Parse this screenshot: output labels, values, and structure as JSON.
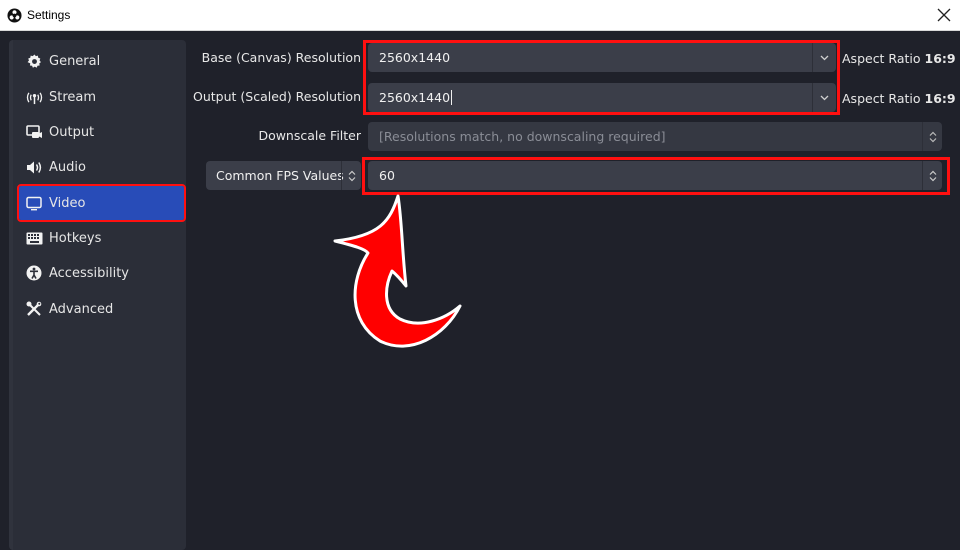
{
  "window": {
    "title": "Settings",
    "app_icon": "obs-logo-icon",
    "close_icon": "close-icon"
  },
  "sidebar": {
    "items": [
      {
        "label": "General",
        "icon": "gear-icon"
      },
      {
        "label": "Stream",
        "icon": "antenna-icon"
      },
      {
        "label": "Output",
        "icon": "output-icon"
      },
      {
        "label": "Audio",
        "icon": "speaker-icon"
      },
      {
        "label": "Video",
        "icon": "monitor-icon",
        "active": true
      },
      {
        "label": "Hotkeys",
        "icon": "keyboard-icon"
      },
      {
        "label": "Accessibility",
        "icon": "accessibility-icon"
      },
      {
        "label": "Advanced",
        "icon": "tools-icon"
      }
    ]
  },
  "video": {
    "base_resolution": {
      "label": "Base (Canvas) Resolution",
      "value": "2560x1440",
      "aspect_label": "Aspect Ratio",
      "aspect_value": "16:9"
    },
    "output_resolution": {
      "label": "Output (Scaled) Resolution",
      "value": "2560x1440",
      "aspect_label": "Aspect Ratio",
      "aspect_value": "16:9"
    },
    "downscale_filter": {
      "label": "Downscale Filter",
      "value": "[Resolutions match, no downscaling required]"
    },
    "fps": {
      "type_label": "Common FPS Values",
      "value": "60"
    }
  },
  "annotation": {
    "highlight_color": "#ff1010",
    "arrow_color": "#ff0000"
  }
}
